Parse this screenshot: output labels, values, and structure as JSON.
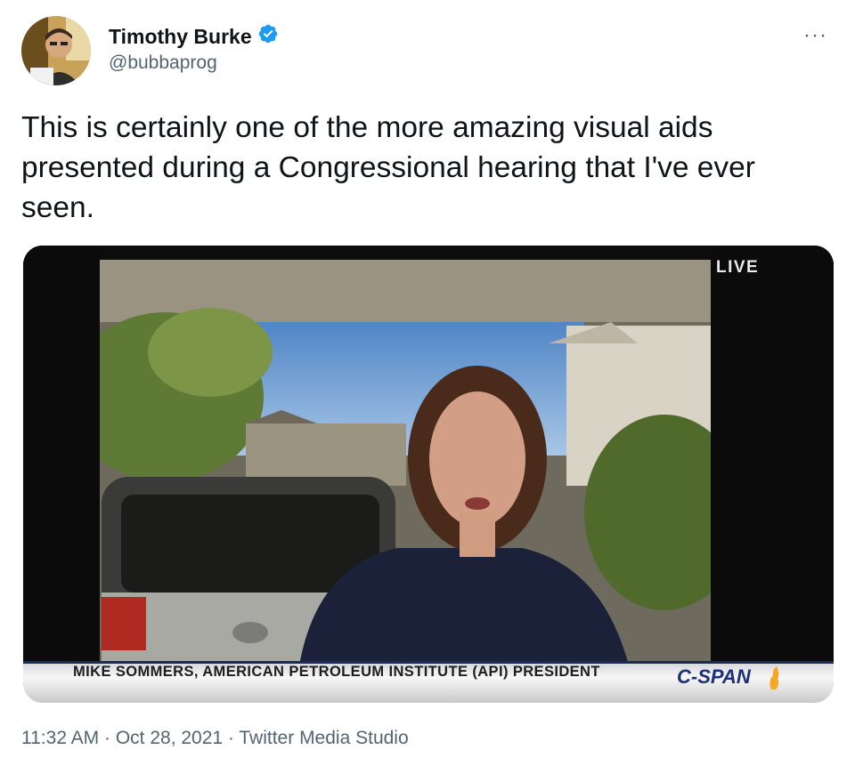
{
  "author": {
    "name": "Timothy Burke",
    "handle": "@bubbaprog",
    "verified": true,
    "verified_color": "#1d9bf0"
  },
  "more_menu_label": "···",
  "tweet": {
    "text": "This is certainly one of the more amazing visual aids presented during a Congressional hearing that I've ever seen."
  },
  "media": {
    "live_label": "LIVE",
    "lower_third": "MIKE SOMMERS, AMERICAN PETROLEUM INSTITUTE (API) PRESIDENT",
    "network": "C-SPAN",
    "accent_colors": {
      "cspan_blue": "#1c2f7a",
      "cspan_orange": "#f5a623"
    }
  },
  "meta": {
    "time": "11:32 AM",
    "separator": " · ",
    "date": "Oct 28, 2021",
    "source": "Twitter Media Studio"
  }
}
